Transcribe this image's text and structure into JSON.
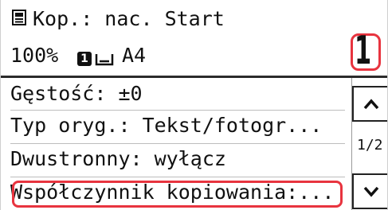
{
  "header": {
    "title": "Kop.: nac. Start",
    "zoom": "100%",
    "paper_count": "1",
    "paper_size": "A4",
    "copies": "1"
  },
  "settings": {
    "items": [
      {
        "label": "Gęstość: ±0"
      },
      {
        "label": "Typ oryg.: Tekst/fotogr..."
      },
      {
        "label": "Dwustronny: wyłącz"
      },
      {
        "label": "Współczynnik kopiowania:..."
      }
    ],
    "page_indicator": "1/2"
  },
  "icons": {
    "copy": "copy-mode-icon",
    "paper": "paper-tray-icon",
    "up": "chevron-up-icon",
    "down": "chevron-down-icon"
  },
  "colors": {
    "highlight": "#e8343f",
    "text": "#111111"
  }
}
